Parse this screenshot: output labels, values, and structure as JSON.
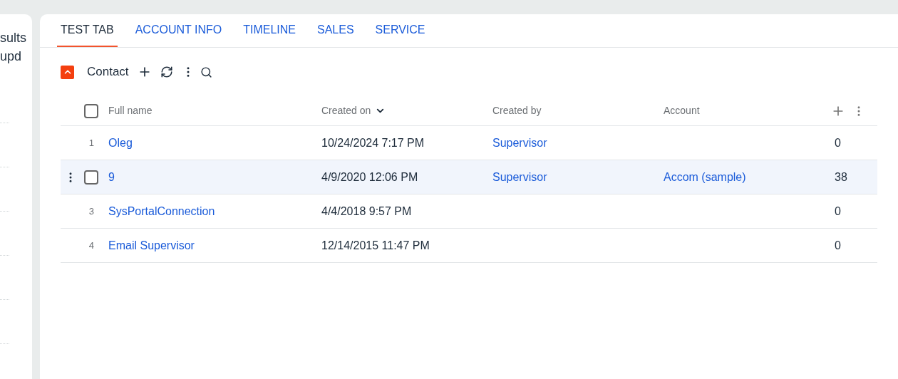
{
  "left_panel": {
    "lines": [
      "sults",
      "upd"
    ]
  },
  "tabs": [
    {
      "label": "TEST TAB",
      "selected": true
    },
    {
      "label": "ACCOUNT INFO",
      "selected": false
    },
    {
      "label": "TIMELINE",
      "selected": false
    },
    {
      "label": "SALES",
      "selected": false
    },
    {
      "label": "SERVICE",
      "selected": false
    }
  ],
  "detail": {
    "title": "Contact",
    "expanded": true
  },
  "table": {
    "all_checked": false,
    "columns": [
      {
        "label": "Full name",
        "sorted": false
      },
      {
        "label": "Created on",
        "sorted": true
      },
      {
        "label": "Created by",
        "sorted": false
      },
      {
        "label": "Account",
        "sorted": false
      }
    ],
    "rows": [
      {
        "number": "1",
        "selected": false,
        "cells": [
          "Oleg",
          "10/24/2024 7:17 PM",
          "Supervisor",
          "",
          "0"
        ]
      },
      {
        "selected": true,
        "checked": false,
        "cells": [
          "9",
          "4/9/2020 12:06 PM",
          "Supervisor",
          "Accom (sample)",
          "38"
        ]
      },
      {
        "number": "3",
        "selected": false,
        "cells": [
          "SysPortalConnection",
          "4/4/2018 9:57 PM",
          "",
          "",
          "0"
        ]
      },
      {
        "number": "4",
        "selected": false,
        "cells": [
          "Email Supervisor",
          "12/14/2015 11:47 PM",
          "",
          "",
          "0"
        ]
      }
    ]
  }
}
